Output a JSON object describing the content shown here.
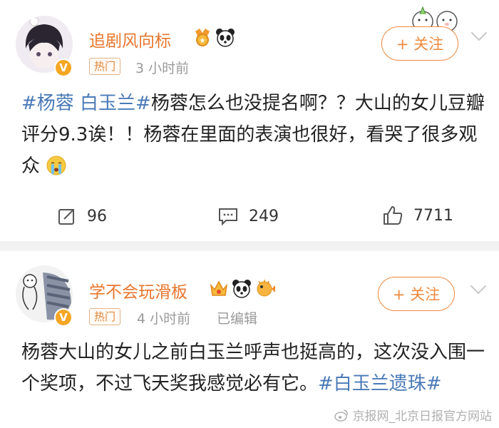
{
  "posts": [
    {
      "user": {
        "name": "追剧风向标",
        "verified_badge": "V",
        "badge_icons": [
          "gold-medal-icon",
          "panda-icon"
        ]
      },
      "tag": "热门",
      "time": "3 小时前",
      "edited": "",
      "follow_label": "+ 关注",
      "text_parts": [
        "#杨蓉 白玉兰#",
        "杨蓉怎么也没提名啊？？大山的女儿豆瓣评分9.3诶！！杨蓉在里面的表演也很好，看哭了很多观众"
      ],
      "emoji": "crying-face-icon",
      "stats": {
        "reposts": "96",
        "comments": "249",
        "likes": "7711"
      }
    },
    {
      "user": {
        "name": "学不会玩滑板",
        "verified_badge": "V",
        "badge_icons": [
          "crown-icon",
          "panda-icon",
          "pufferfish-icon"
        ]
      },
      "tag": "热门",
      "time": "4 小时前",
      "edited": "已编辑",
      "follow_label": "+ 关注",
      "text_parts": [
        "杨蓉大山的女儿之前白玉兰呼声也挺高的，这次没入围一个奖项，不过飞天奖我感觉必有它。",
        "#白玉兰遗珠#"
      ]
    }
  ],
  "watermark": "京报网_北京日报官方网站",
  "colors": {
    "accent": "#f0883c",
    "link": "#4a7ab8",
    "username": "#e8762d"
  }
}
